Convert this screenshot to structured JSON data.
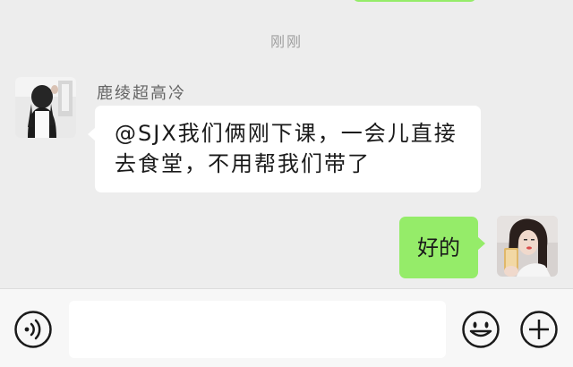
{
  "chat": {
    "timestamp": "刚刚",
    "messages": [
      {
        "sender": "鹿绫超高冷",
        "direction": "incoming",
        "text_line1": "@SJX我们俩刚下课，一会儿直接",
        "text_line2": "去食堂，不用帮我们带了"
      },
      {
        "direction": "outgoing",
        "text": "好的"
      }
    ]
  },
  "input_bar": {
    "value": "",
    "icons": [
      "voice-icon",
      "emoji-icon",
      "plus-icon"
    ]
  },
  "colors": {
    "background": "#ededed",
    "outgoing_bubble": "#95ec69",
    "incoming_bubble": "#ffffff",
    "input_bar": "#f7f7f7"
  }
}
